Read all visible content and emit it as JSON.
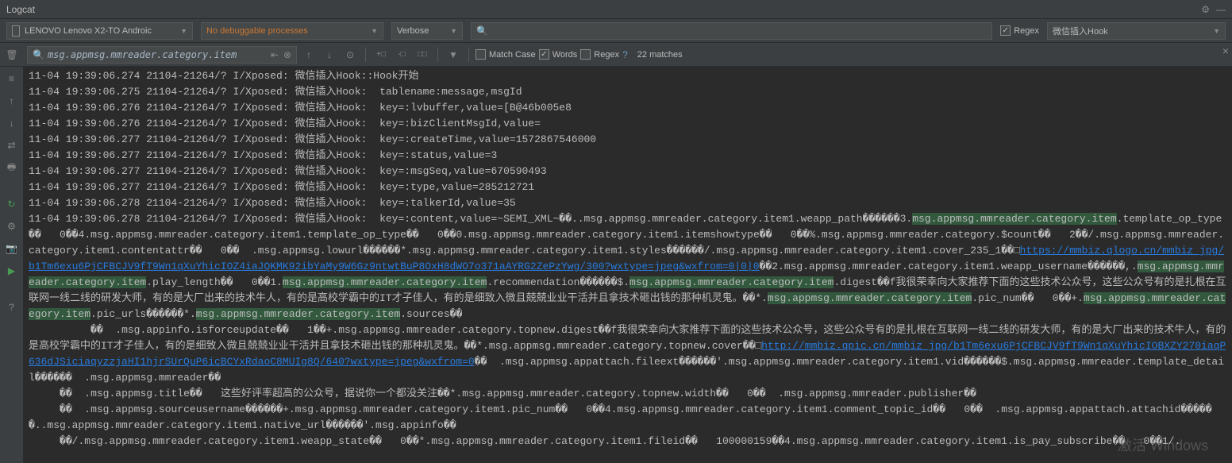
{
  "title": "Logcat",
  "device": "LENOVO Lenovo X2-TO Androic",
  "process": "No debuggable processes",
  "level": "Verbose",
  "regex_label": "Regex",
  "filter": "微信插入Hook",
  "find_value": "msg.appmsg.mmreader.category.item",
  "match_case": "Match Case",
  "words": "Words",
  "regex2": "Regex",
  "matches": "22 matches",
  "watermark": "激活 Windows",
  "lines": [
    "11-04 19:39:06.274 21104-21264/? I/Xposed: 微信插入Hook::Hook开始",
    "11-04 19:39:06.275 21104-21264/? I/Xposed: 微信插入Hook:  tablename:message,msgId",
    "11-04 19:39:06.276 21104-21264/? I/Xposed: 微信插入Hook:  key=:lvbuffer,value=[B@46b005e8",
    "11-04 19:39:06.276 21104-21264/? I/Xposed: 微信插入Hook:  key=:bizClientMsgId,value=",
    "11-04 19:39:06.277 21104-21264/? I/Xposed: 微信插入Hook:  key=:createTime,value=1572867546000",
    "11-04 19:39:06.277 21104-21264/? I/Xposed: 微信插入Hook:  key=:status,value=3",
    "11-04 19:39:06.277 21104-21264/? I/Xposed: 微信插入Hook:  key=:msgSeq,value=670590493",
    "11-04 19:39:06.277 21104-21264/? I/Xposed: 微信插入Hook:  key=:type,value=285212721",
    "11-04 19:39:06.278 21104-21264/? I/Xposed: 微信插入Hook:  key=:talkerId,value=35"
  ],
  "wrap": {
    "prefix": "11-04 19:39:06.278 21104-21264/? I/Xposed: 微信插入Hook:  key=:content,value=~SEMI_XML~��..msg.appmsg.mmreader.category.item1.weapp_path������3.",
    "hl1": "msg.appmsg.mmreader.category.item",
    "t1": ".template_op_type��   0��4.msg.appmsg.mmreader.category.item1.template_op_type��   0��0.msg.appmsg.mmreader.category.item1.itemshowtype��   0��%.msg.appmsg.mmreader.category.$count��   2��/.msg.appmsg.mmreader.category.item1.contentattr��   0��  .msg.appmsg.lowurl������*.msg.appmsg.mmreader.category.item1.styles������/.msg.appmsg.mmreader.category.item1.cover_235_1��□",
    "link1": "https://mmbiz.qlogo.cn/mmbiz_jpg/b1Tm6exu6PjCFBCJV9fT9Wn1qXuYhicIOZ4iaJQKMK92ibYaMy9W6Gz9ntwtBuP8OxH8dWO7o371aAYRG2ZePzYwg/300?wxtype=jpeg&wxfrom=0|0|0",
    "t2": "��2.msg.appmsg.mmreader.category.item1.weapp_username������,.",
    "hl2": "msg.appmsg.mmreader.category.item",
    "t3": ".play_length��   0��1.",
    "hl3": "msg.appmsg.mmreader.category.item",
    "t4": ".recommendation������$.",
    "hl4": "msg.appmsg.mmreader.category.item",
    "t5": ".digest��f我很荣幸向大家推荐下面的这些技术公众号，这些公众号有的是扎根在互联网一线二线的研发大师，有的是大厂出来的技术牛人，有的是高校学霸中的IT才子佳人，有的是细致入微且兢兢业业干活并且拿技术砸出钱的那种机灵鬼。��*.",
    "hl5": "msg.appmsg.mmreader.category.item",
    "t6": ".pic_num��   0��+.",
    "hl6": "msg.appmsg.mmreader.category.item",
    "t7": ".pic_urls������*.",
    "hl7": "msg.appmsg.mmreader.category.item",
    "t8": ".sources��",
    "t9": "          ��  .msg.appinfo.isforceupdate��   1��+.msg.appmsg.mmreader.category.topnew.digest��f我很荣幸向大家推荐下面的这些技术公众号，这些公众号有的是扎根在互联网一线二线的研发大师，有的是大厂出来的技术牛人，有的是高校学霸中的IT才子佳人，有的是细致入微且兢兢业业干活并且拿技术砸出钱的那种机灵鬼。��*.msg.appmsg.mmreader.category.topnew.cover��□",
    "link2": "http://mmbiz.qpic.cn/mmbiz_jpg/b1Tm6exu6PjCFBCJV9fT9Wn1qXuYhicIOBXZY270iaqP636dJSiciaqyzzjaHI1hjrSUrQuP6icBCYxRdaoC8MUIg8Q/640?wxtype=jpeg&wxfrom=0",
    "t10": "��  .msg.appmsg.appattach.fileext������'.msg.appmsg.mmreader.category.item1.vid������$.msg.appmsg.mmreader.template_detail������  .msg.appmsg.mmreader��",
    "t11": "     ��  .msg.appmsg.title��   这些好评率超高的公众号，据说你一个都没关注��*.msg.appmsg.mmreader.category.topnew.width��   0��  .msg.appmsg.mmreader.publisher��",
    "t12": "     ��  .msg.appmsg.sourceusername������+.msg.appmsg.mmreader.category.item1.pic_num��   0��4.msg.appmsg.mmreader.category.item1.comment_topic_id��   0��  .msg.appmsg.appattach.attachid������..msg.appmsg.mmreader.category.item1.native_url������'.msg.appinfo��",
    "t13": "     ��/.msg.appmsg.mmreader.category.item1.weapp_state��   0��*.msg.appmsg.mmreader.category.item1.fileid��   100000159��4.msg.appmsg.mmreader.category.item1.is_pay_subscribe��   0��1/."
  }
}
